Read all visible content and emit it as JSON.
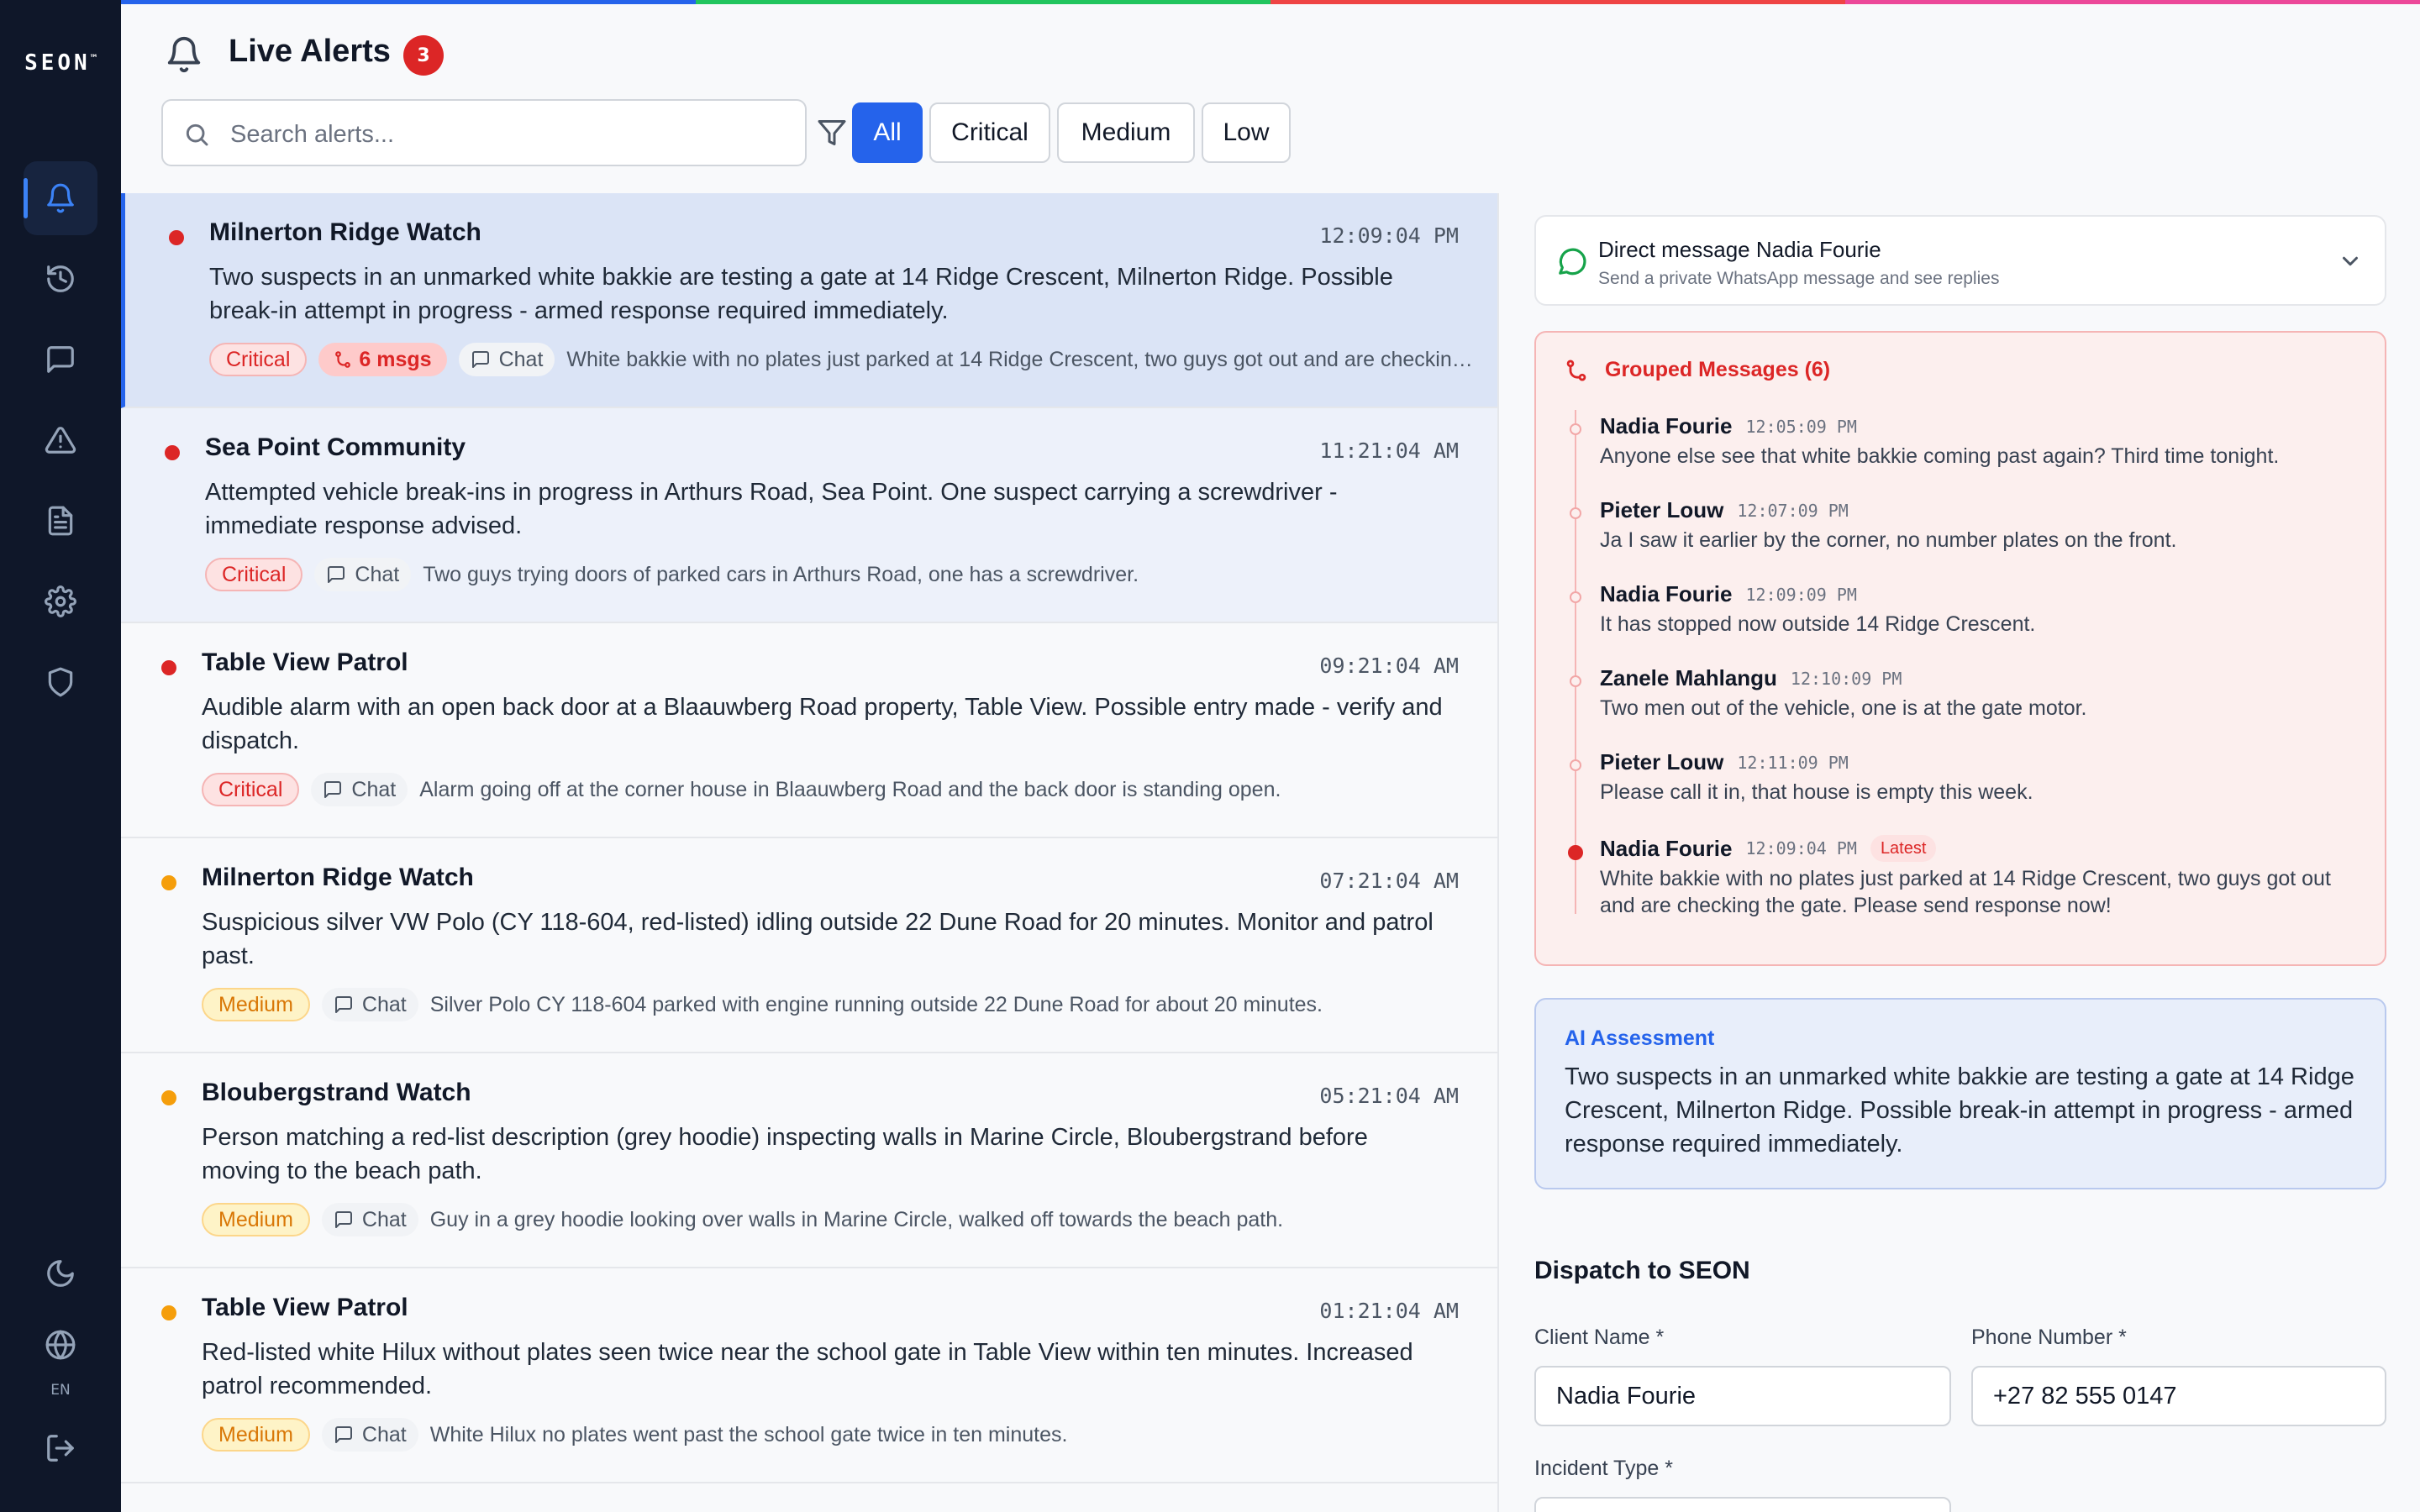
{
  "app": {
    "logo": "SEON",
    "logo_tm": "™",
    "lang": "EN",
    "stripe_colors": [
      "#2563eb",
      "#22c55e",
      "#ef4444",
      "#ec4899"
    ]
  },
  "sidebar": {
    "items": [
      {
        "name": "alerts",
        "icon": "bell-icon",
        "active": true
      },
      {
        "name": "history",
        "icon": "history-icon",
        "active": false
      },
      {
        "name": "messages",
        "icon": "chat-icon",
        "active": false
      },
      {
        "name": "incidents",
        "icon": "warning-icon",
        "active": false
      },
      {
        "name": "reports",
        "icon": "document-icon",
        "active": false
      },
      {
        "name": "settings",
        "icon": "gear-icon",
        "active": false
      },
      {
        "name": "security",
        "icon": "shield-icon",
        "active": false
      }
    ],
    "bottom": [
      {
        "name": "theme",
        "icon": "moon-icon"
      },
      {
        "name": "language",
        "icon": "globe-icon"
      },
      {
        "name": "logout",
        "icon": "logout-icon"
      }
    ]
  },
  "header": {
    "title": "Live Alerts",
    "count": "3",
    "search_placeholder": "Search alerts...",
    "filters": [
      "All",
      "Critical",
      "Medium",
      "Low"
    ],
    "active_filter": "All"
  },
  "alerts": [
    {
      "group": "Milnerton Ridge Watch",
      "time": "12:09:04 PM",
      "description": "Two suspects in an unmarked white bakkie are testing a gate at 14 Ridge Crescent, Milnerton Ridge. Possible break-in attempt in progress - armed response required immediately.",
      "severity": "Critical",
      "msgs": "6 msgs",
      "source": "Chat",
      "snippet": "White bakkie with no plates just parked at 14 Ridge Crescent, two guys got out and are checking the gate. Please send response now!"
    },
    {
      "group": "Sea Point Community",
      "time": "11:21:04 AM",
      "description": "Attempted vehicle break-ins in progress in Arthurs Road, Sea Point. One suspect carrying a screwdriver - immediate response advised.",
      "severity": "Critical",
      "source": "Chat",
      "snippet": "Two guys trying doors of parked cars in Arthurs Road, one has a screwdriver."
    },
    {
      "group": "Table View Patrol",
      "time": "09:21:04 AM",
      "description": "Audible alarm with an open back door at a Blaauwberg Road property, Table View. Possible entry made - verify and dispatch.",
      "severity": "Critical",
      "source": "Chat",
      "snippet": "Alarm going off at the corner house in Blaauwberg Road and the back door is standing open."
    },
    {
      "group": "Milnerton Ridge Watch",
      "time": "07:21:04 AM",
      "description": "Suspicious silver VW Polo (CY 118-604, red-listed) idling outside 22 Dune Road for 20 minutes. Monitor and patrol past.",
      "severity": "Medium",
      "source": "Chat",
      "snippet": "Silver Polo CY 118-604 parked with engine running outside 22 Dune Road for about 20 minutes."
    },
    {
      "group": "Bloubergstrand Watch",
      "time": "05:21:04 AM",
      "description": "Person matching a red-list description (grey hoodie) inspecting walls in Marine Circle, Bloubergstrand before moving to the beach path.",
      "severity": "Medium",
      "source": "Chat",
      "snippet": "Guy in a grey hoodie looking over walls in Marine Circle, walked off towards the beach path."
    },
    {
      "group": "Table View Patrol",
      "time": "01:21:04 AM",
      "description": "Red-listed white Hilux without plates seen twice near the school gate in Table View within ten minutes. Increased patrol recommended.",
      "severity": "Medium",
      "source": "Chat",
      "snippet": "White Hilux no plates went past the school gate twice in ten minutes."
    }
  ],
  "detail": {
    "dm_title": "Direct message Nadia Fourie",
    "dm_subtitle": "Send a private WhatsApp message and see replies",
    "grouped_title": "Grouped Messages (6)",
    "messages": [
      {
        "name": "Nadia Fourie",
        "time": "12:05:09 PM",
        "text": "Anyone else see that white bakkie coming past again? Third time tonight."
      },
      {
        "name": "Pieter Louw",
        "time": "12:07:09 PM",
        "text": "Ja I saw it earlier by the corner, no number plates on the front."
      },
      {
        "name": "Nadia Fourie",
        "time": "12:09:09 PM",
        "text": "It has stopped now outside 14 Ridge Crescent."
      },
      {
        "name": "Zanele Mahlangu",
        "time": "12:10:09 PM",
        "text": "Two men out of the vehicle, one is at the gate motor."
      },
      {
        "name": "Pieter Louw",
        "time": "12:11:09 PM",
        "text": "Please call it in, that house is empty this week."
      },
      {
        "name": "Nadia Fourie",
        "time": "12:09:04 PM",
        "text": "White bakkie with no plates just parked at 14 Ridge Crescent, two guys got out and are checking the gate. Please send response now!",
        "badge": "Latest"
      }
    ],
    "ai_label": "AI Assessment",
    "ai_text": "Two suspects in an unmarked white bakkie are testing a gate at 14 Ridge Crescent, Milnerton Ridge. Possible break-in attempt in progress - armed response required immediately.",
    "dispatch_title": "Dispatch to SEON",
    "client_name_label": "Client Name *",
    "client_name": "Nadia Fourie",
    "phone_label": "Phone Number *",
    "phone": "+27 82 555 0147",
    "incident_type_label": "Incident Type *"
  },
  "colors": {
    "critical": "#dc2626",
    "medium": "#f59e0b",
    "accent": "#2563eb",
    "sidebar": "#0f1729"
  }
}
